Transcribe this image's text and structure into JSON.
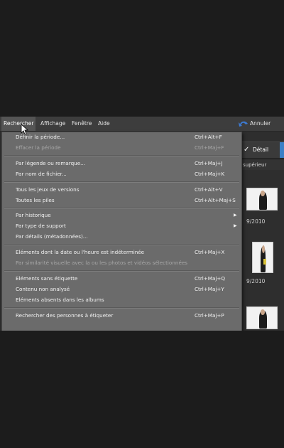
{
  "menubar": {
    "items": [
      {
        "label": "Rechercher"
      },
      {
        "label": "Affichage"
      },
      {
        "label": "Fenêtre"
      },
      {
        "label": "Aide"
      }
    ],
    "undo_label": "Annuler"
  },
  "viewbar": {
    "detail_label": "Détail"
  },
  "sort": {
    "value": "supérieur"
  },
  "dates": [
    "9/2010",
    "9/2010"
  ],
  "menu": {
    "items": [
      {
        "label": "Définir la période...",
        "shortcut": "Ctrl+Alt+F",
        "enabled": true
      },
      {
        "label": "Effacer la période",
        "shortcut": "Ctrl+Maj+F",
        "enabled": false
      },
      {
        "label": "Par légende ou remarque...",
        "shortcut": "Ctrl+Maj+J",
        "enabled": true
      },
      {
        "label": "Par nom de fichier...",
        "shortcut": "Ctrl+Maj+K",
        "enabled": true
      },
      {
        "label": "Tous les jeux de versions",
        "shortcut": "Ctrl+Alt+V",
        "enabled": true
      },
      {
        "label": "Toutes les piles",
        "shortcut": "Ctrl+Alt+Maj+S",
        "enabled": true
      },
      {
        "label": "Par historique",
        "shortcut": "",
        "enabled": true,
        "submenu": true
      },
      {
        "label": "Par type de support",
        "shortcut": "",
        "enabled": true,
        "submenu": true
      },
      {
        "label": "Par détails (métadonnées)...",
        "shortcut": "",
        "enabled": true
      },
      {
        "label": "Eléments dont la date ou l'heure est indéterminée",
        "shortcut": "Ctrl+Maj+X",
        "enabled": true
      },
      {
        "label": "Par similarité visuelle avec la ou les photos et vidéos sélectionnées",
        "shortcut": "",
        "enabled": false
      },
      {
        "label": "Eléments sans étiquette",
        "shortcut": "Ctrl+Maj+Q",
        "enabled": true
      },
      {
        "label": "Contenu non analysé",
        "shortcut": "Ctrl+Maj+Y",
        "enabled": true
      },
      {
        "label": "Eléments absents dans les albums",
        "shortcut": "",
        "enabled": true
      },
      {
        "label": "Rechercher des personnes à étiqueter",
        "shortcut": "Ctrl+Maj+P",
        "enabled": true
      }
    ]
  }
}
